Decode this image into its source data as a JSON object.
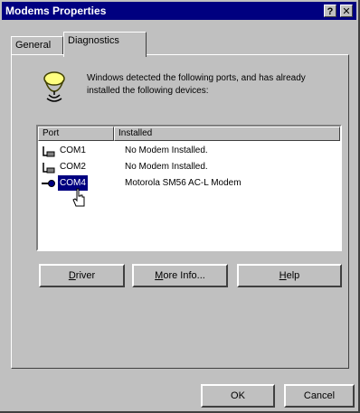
{
  "window": {
    "title": "Modems Properties",
    "help_glyph": "?",
    "close_glyph": "✕"
  },
  "tabs": {
    "general": "General",
    "diagnostics": "Diagnostics"
  },
  "info": {
    "text": "Windows detected the following ports, and has already installed the following devices:"
  },
  "list": {
    "headers": {
      "port": "Port",
      "installed": "Installed"
    },
    "rows": [
      {
        "port": "COM1",
        "installed": "No Modem Installed."
      },
      {
        "port": "COM2",
        "installed": "No Modem Installed."
      },
      {
        "port": "COM4",
        "installed": "Motorola SM56 AC-L Modem",
        "selected": true
      }
    ]
  },
  "buttons": {
    "driver": {
      "first": "D",
      "rest": "river"
    },
    "more_info": {
      "first": "M",
      "rest": "ore Info..."
    },
    "help": {
      "first": "H",
      "rest": "elp"
    },
    "ok": "OK",
    "cancel": "Cancel"
  },
  "colors": {
    "titlebar": "#000080",
    "face": "#c0c0c0",
    "selection": "#000080"
  }
}
